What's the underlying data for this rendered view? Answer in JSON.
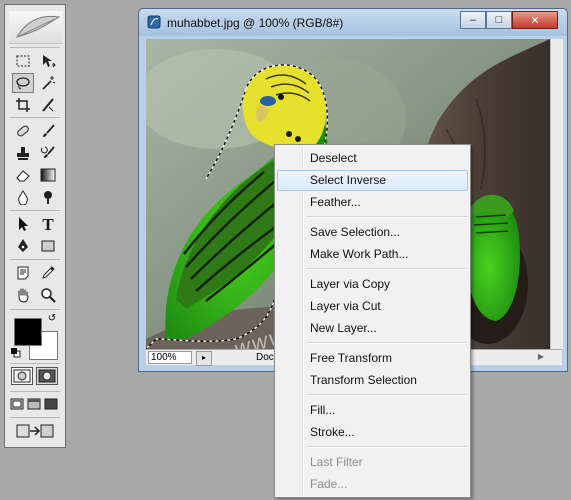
{
  "toolbox": {
    "tools": [
      {
        "name": "rectangular-marquee-tool"
      },
      {
        "name": "move-tool"
      },
      {
        "name": "lasso-tool"
      },
      {
        "name": "magic-wand-tool"
      },
      {
        "name": "crop-tool"
      },
      {
        "name": "slice-tool"
      },
      {
        "name": "healing-brush-tool"
      },
      {
        "name": "brush-tool"
      },
      {
        "name": "clone-stamp-tool"
      },
      {
        "name": "history-brush-tool"
      },
      {
        "name": "eraser-tool"
      },
      {
        "name": "gradient-tool"
      },
      {
        "name": "blur-tool"
      },
      {
        "name": "dodge-tool"
      },
      {
        "name": "path-selection-tool"
      },
      {
        "name": "type-tool",
        "glyph": "T"
      },
      {
        "name": "pen-tool"
      },
      {
        "name": "shape-tool"
      },
      {
        "name": "notes-tool"
      },
      {
        "name": "eyedropper-tool"
      },
      {
        "name": "hand-tool"
      },
      {
        "name": "zoom-tool"
      }
    ],
    "active_tool": "lasso-tool",
    "foreground_color": "#000000",
    "background_color": "#ffffff"
  },
  "document": {
    "title": "muhabbet.jpg @ 100% (RGB/8#)",
    "minimize_label": "–",
    "maximize_label": "□",
    "close_label": "✕",
    "zoom": "100%",
    "status_text": "Doc",
    "watermark": "www.teknobeyin.com"
  },
  "context_menu": {
    "items": [
      {
        "label": "Deselect",
        "enabled": true
      },
      {
        "label": "Select Inverse",
        "enabled": true,
        "highlighted": true
      },
      {
        "label": "Feather...",
        "enabled": true
      },
      {
        "label": "Save Selection...",
        "enabled": true
      },
      {
        "label": "Make Work Path...",
        "enabled": true
      },
      {
        "label": "Layer via Copy",
        "enabled": true
      },
      {
        "label": "Layer via Cut",
        "enabled": true
      },
      {
        "label": "New Layer...",
        "enabled": true
      },
      {
        "label": "Free Transform",
        "enabled": true
      },
      {
        "label": "Transform Selection",
        "enabled": true
      },
      {
        "label": "Fill...",
        "enabled": true
      },
      {
        "label": "Stroke...",
        "enabled": true
      },
      {
        "label": "Last Filter",
        "enabled": false
      },
      {
        "label": "Fade...",
        "enabled": false
      }
    ]
  },
  "colors": {
    "highlight_bg": "#dbe9f8",
    "titlebar": "#b9d0e8",
    "desktop": "#a9a9a9"
  }
}
